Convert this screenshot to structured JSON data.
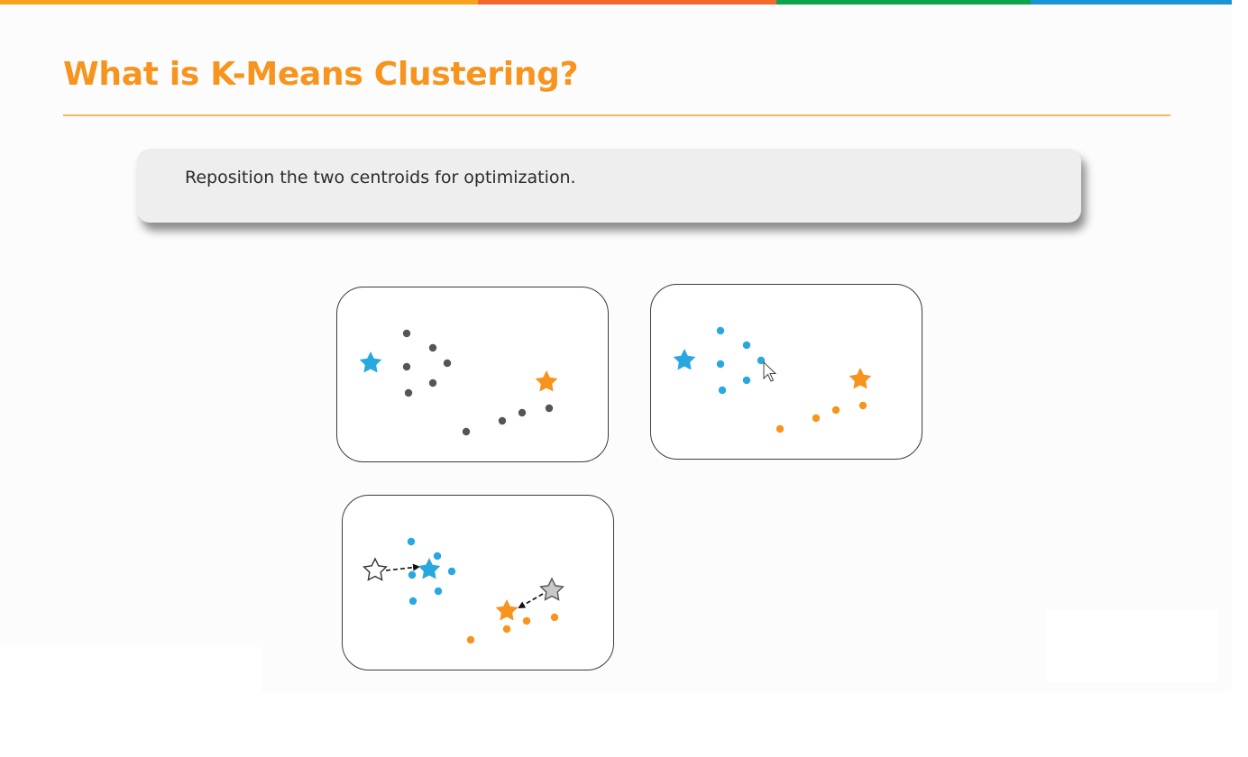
{
  "slide": {
    "title": "What is K-Means Clustering?",
    "instruction": "Reposition the two centroids for optimization."
  },
  "colors": {
    "title": "#f7941d",
    "top_bar": [
      "#f7a21b",
      "#f26a2b",
      "#0fa14b",
      "#1a93d3"
    ],
    "cluster_blue": "#29a8e0",
    "cluster_orange": "#f7941d",
    "unassigned_point": "#555555",
    "old_centroid_gray": "#c8c8c8"
  },
  "icons": {
    "centroid": "star-icon",
    "data_point": "dot-icon",
    "move_arrow": "dashed-arrow-icon",
    "mouse_pointer": "cursor-icon"
  },
  "panels": [
    {
      "step": "initial centroids",
      "centroids": [
        {
          "color": "blue",
          "style": "filled"
        },
        {
          "color": "orange",
          "style": "filled"
        }
      ],
      "point_count": 10,
      "point_colors": "gray"
    },
    {
      "step": "points assigned to nearest centroid",
      "centroids": [
        {
          "color": "blue",
          "style": "filled"
        },
        {
          "color": "orange",
          "style": "filled"
        }
      ],
      "blue_points": 6,
      "orange_points": 4
    },
    {
      "step": "centroids repositioned",
      "centroids": [
        {
          "color": "white",
          "style": "outline-old"
        },
        {
          "color": "blue",
          "style": "filled-new"
        },
        {
          "color": "gray",
          "style": "outline-old"
        },
        {
          "color": "orange",
          "style": "filled-new"
        }
      ],
      "blue_points": 6,
      "orange_points": 4
    }
  ]
}
